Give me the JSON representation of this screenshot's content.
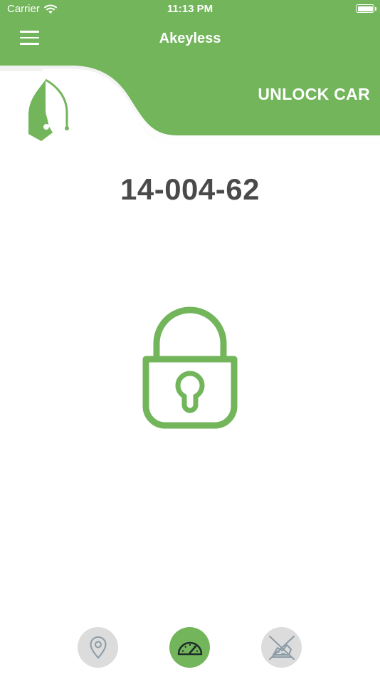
{
  "status_bar": {
    "carrier": "Carrier",
    "time": "11:13 PM"
  },
  "header": {
    "title": "Akeyless",
    "action_title": "UNLOCK CAR"
  },
  "car": {
    "plate": "14-004-62"
  },
  "lock": {
    "state": "locked"
  },
  "bottom_nav": {
    "items": [
      {
        "icon": "location-pin-icon",
        "active": false
      },
      {
        "icon": "speedometer-icon",
        "active": true
      },
      {
        "icon": "engine-blocked-icon",
        "active": false
      }
    ]
  },
  "colors": {
    "brand_green": "#72b55b",
    "plate_text": "#4a4a4a",
    "inactive_nav": "#dcdcdc",
    "inactive_icon": "#8a9aa5"
  }
}
